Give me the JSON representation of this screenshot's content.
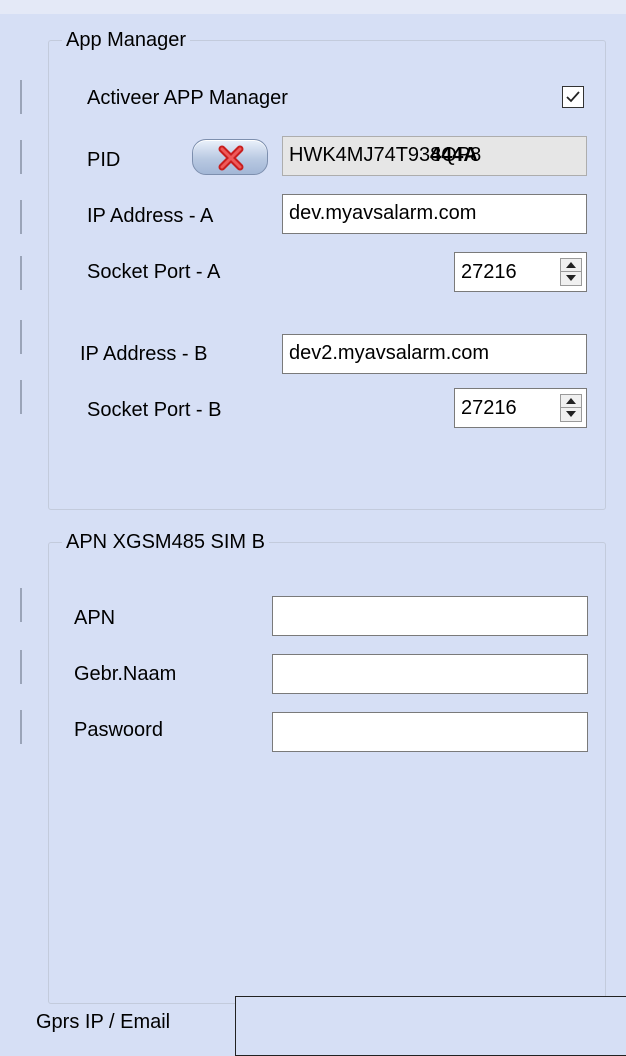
{
  "app_manager": {
    "legend": "App Manager",
    "activate_label": "Activeer APP Manager",
    "activate_checked": true,
    "pid_label": "PID",
    "pid_value": "HWK4MJ74T938QP8",
    "pid_overlay": "444A",
    "ip_a_label": "IP Address  - A",
    "ip_a_value": "dev.myavsalarm.com",
    "port_a_label": "Socket Port - A",
    "port_a_value": "27216",
    "ip_b_label": "IP Address - B",
    "ip_b_value": "dev2.myavsalarm.com",
    "port_b_label": "Socket Port - B",
    "port_b_value": "27216"
  },
  "apn_group": {
    "legend": "APN XGSM485 SIM B",
    "apn_label": "APN",
    "apn_value": "",
    "user_label": "Gebr.Naam",
    "user_value": "",
    "password_label": "Paswoord",
    "password_value": ""
  },
  "bottom": {
    "label": "Gprs IP / Email"
  },
  "icons": {
    "clear": "red-x-icon",
    "check": "checkmark-icon"
  }
}
